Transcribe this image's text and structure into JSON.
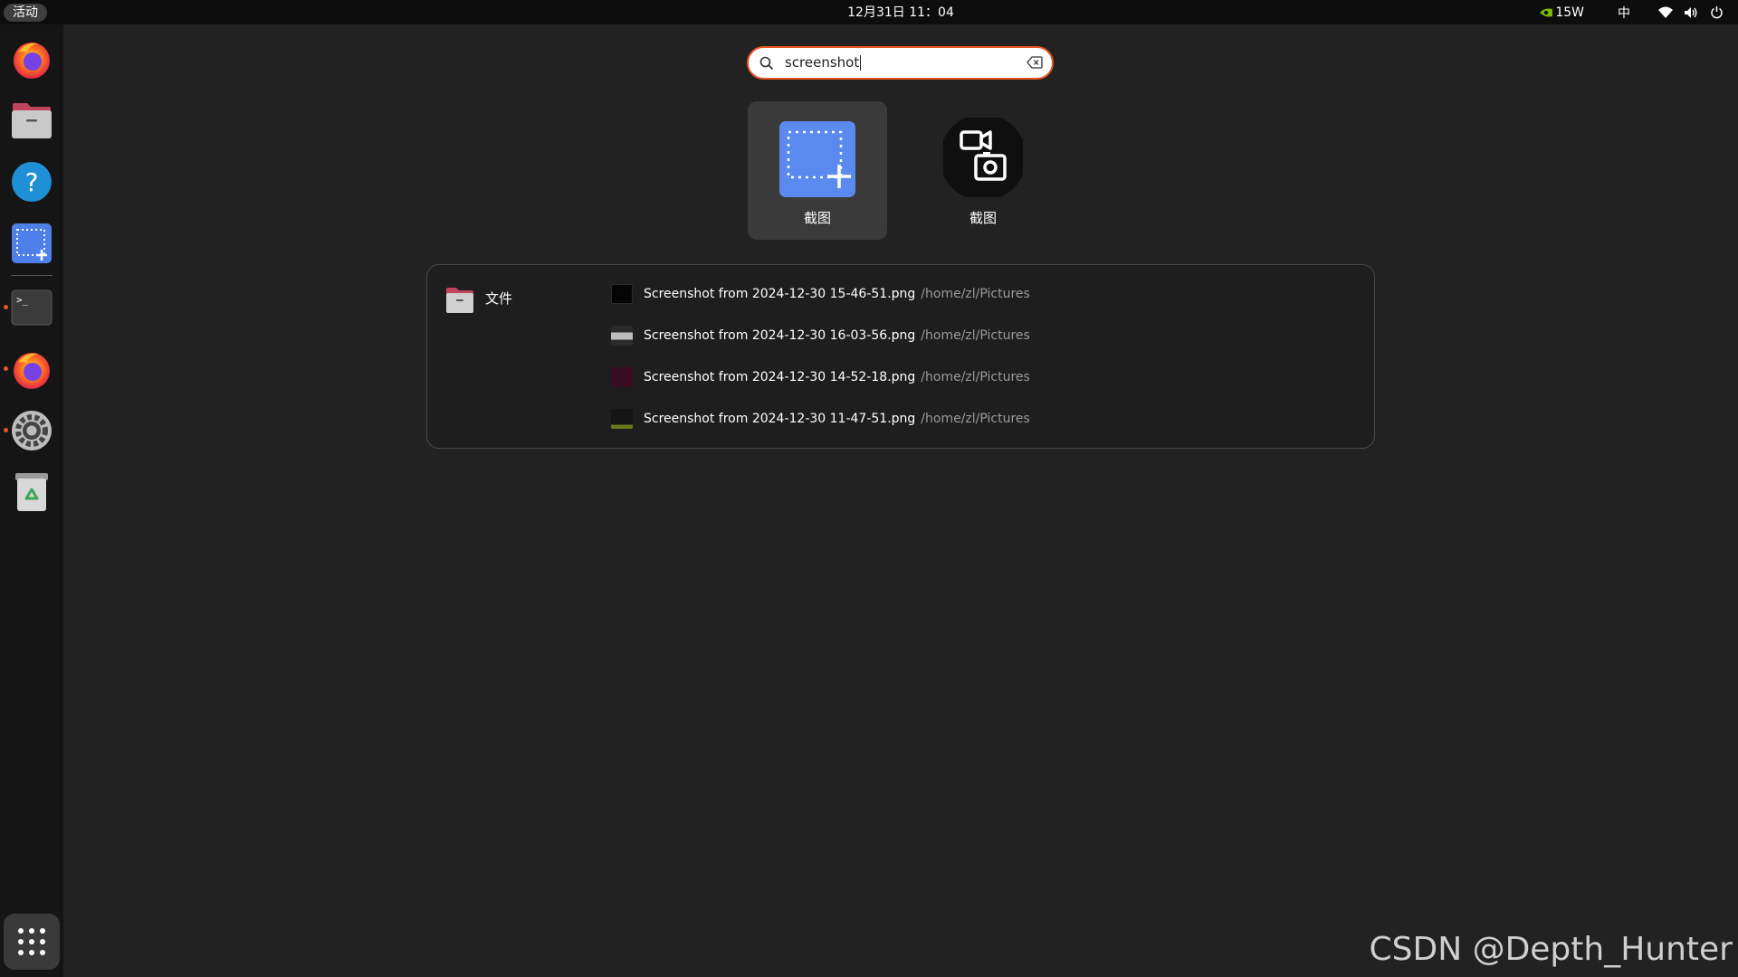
{
  "topbar": {
    "activities_label": "活动",
    "clock": "12月31日  11：04",
    "power_label": "15W",
    "input_method": "中"
  },
  "dock": {
    "apps": [
      {
        "icon": "firefox-icon",
        "running": false
      },
      {
        "icon": "files-icon",
        "running": false
      },
      {
        "icon": "help-icon",
        "running": false
      },
      {
        "icon": "screenshot-icon",
        "running": false
      },
      {
        "icon": "terminal-icon",
        "running": true
      },
      {
        "icon": "firefox-icon",
        "running": true
      },
      {
        "icon": "settings-icon",
        "running": true
      },
      {
        "icon": "trash-icon",
        "running": false
      }
    ],
    "show_apps_icon": "grid-icon"
  },
  "search": {
    "value": "screenshot"
  },
  "app_results": [
    {
      "label": "截图",
      "icon": "screenshot-app-icon",
      "selected": true
    },
    {
      "label": "截图",
      "icon": "screen-record-icon",
      "selected": false
    }
  ],
  "file_results": {
    "provider_label": "文件",
    "provider_icon": "folder-icon",
    "files": [
      {
        "name": "Screenshot from 2024-12-30 15-46-51.png",
        "path": "/home/zl/Pictures"
      },
      {
        "name": "Screenshot from 2024-12-30 16-03-56.png",
        "path": "/home/zl/Pictures"
      },
      {
        "name": "Screenshot from 2024-12-30 14-52-18.png",
        "path": "/home/zl/Pictures"
      },
      {
        "name": "Screenshot from 2024-12-30 11-47-51.png",
        "path": "/home/zl/Pictures"
      }
    ]
  },
  "watermark": "CSDN @Depth_Hunter",
  "colors": {
    "accent": "#e95420",
    "background": "#222222",
    "dock": "#151515",
    "topbar": "#0d0d0d"
  }
}
